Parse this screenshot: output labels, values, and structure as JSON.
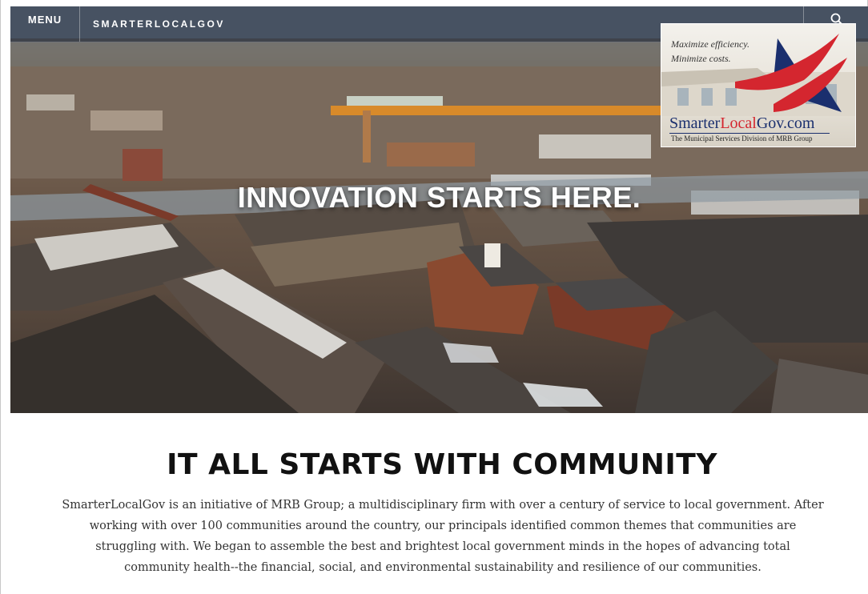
{
  "header": {
    "menu_label": "MENU",
    "brand": "SMARTERLOCALGOV",
    "search_icon": "search-icon"
  },
  "hero": {
    "title": "INNOVATION STARTS HERE."
  },
  "ad": {
    "tagline_1": "Maximize efficiency.",
    "tagline_2": "Minimize costs.",
    "logo_part_1": "Smarter",
    "logo_part_2": "Local",
    "logo_part_3": "Gov.com",
    "subtitle": "The Municipal Services Division of MRB Group",
    "colors": {
      "navy": "#1a2f6e",
      "red": "#d4262f"
    }
  },
  "content": {
    "heading": "IT ALL STARTS WITH COMMUNITY",
    "lines": [
      "SmarterLocalGov is an initiative of MRB Group; a multidisciplinary firm with over a century of service to local government.  After",
      "working with over 100 communities around the country, our principals identified common themes that communities are",
      "struggling with.  We began to assemble the best and brightest local government minds in the hopes of advancing total",
      "community health--the financial, social, and environmental sustainability and resilience of our communities."
    ]
  }
}
